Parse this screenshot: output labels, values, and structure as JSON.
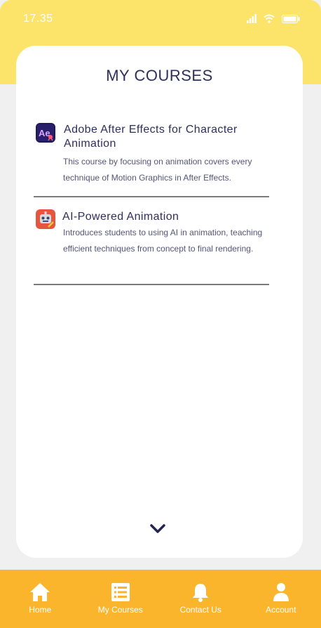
{
  "status": {
    "time": "17.35"
  },
  "page": {
    "title": "MY COURSES"
  },
  "courses": [
    {
      "title": "Adobe After Effects for Character Animation",
      "description": "This course by focusing on animation covers every technique of Motion Graphics in After Effects.",
      "icon": "after-effects-icon"
    },
    {
      "title": "AI-Powered Animation",
      "description": "Introduces students to using AI in animation, teaching efficient techniques from concept to final rendering.",
      "icon": "robot-icon"
    }
  ],
  "nav": [
    {
      "label": "Home",
      "icon": "home-icon"
    },
    {
      "label": "My Courses",
      "icon": "list-icon"
    },
    {
      "label": "Contact Us",
      "icon": "bell-icon"
    },
    {
      "label": "Account",
      "icon": "person-icon"
    }
  ],
  "colors": {
    "header": "#fce46a",
    "nav": "#fbb52d",
    "title": "#2e2f5c",
    "background": "#f0f0f0"
  }
}
